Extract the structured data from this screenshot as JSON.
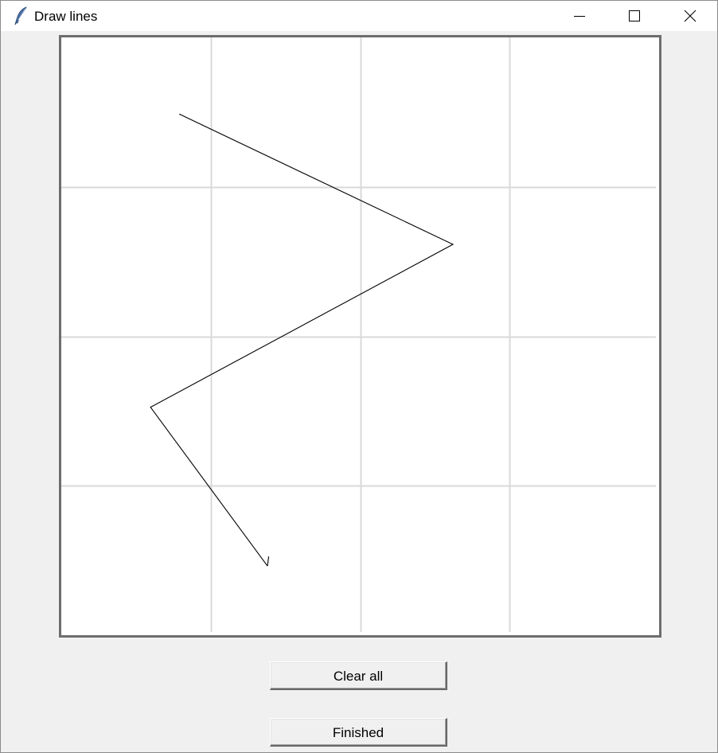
{
  "window": {
    "title": "Draw lines",
    "controls": [
      "minimize",
      "maximize",
      "close"
    ]
  },
  "canvas": {
    "background": "#ffffff",
    "grid_color": "#d9d9d9",
    "line_color": "#000000",
    "grid": {
      "columns": 4,
      "rows": 4
    },
    "polyline_points": [
      [
        0.1973,
        0.1282
      ],
      [
        0.6551,
        0.3462
      ],
      [
        0.1493,
        0.6186
      ],
      [
        0.3449,
        0.8843
      ]
    ]
  },
  "buttons": {
    "clear_label": "Clear all",
    "finished_label": "Finished"
  },
  "icons": {
    "app": "feather-icon",
    "minimize": "minimize-icon",
    "maximize": "maximize-icon",
    "close": "close-icon"
  }
}
